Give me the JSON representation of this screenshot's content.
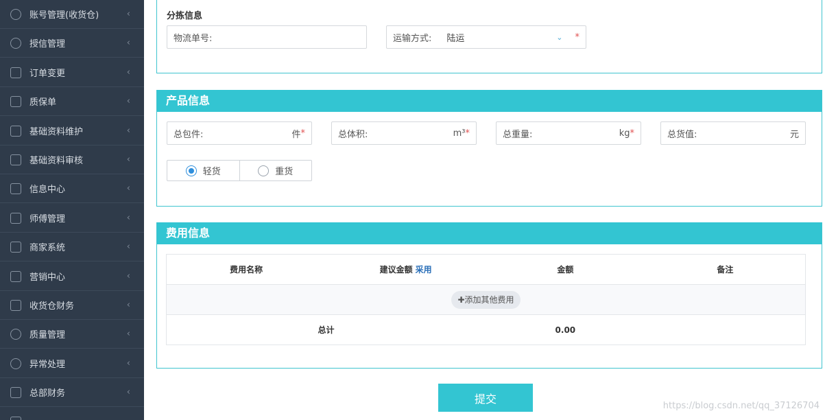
{
  "sidebar": {
    "items": [
      {
        "label": "账号管理(收货仓)",
        "icon": "gear-icon"
      },
      {
        "label": "授信管理",
        "icon": "user-icon"
      },
      {
        "label": "订单变更",
        "icon": "doc-icon"
      },
      {
        "label": "质保单",
        "icon": "doc-icon"
      },
      {
        "label": "基础资料维护",
        "icon": "grid-icon"
      },
      {
        "label": "基础资料审核",
        "icon": "grid-icon"
      },
      {
        "label": "信息中心",
        "icon": "grid-icon"
      },
      {
        "label": "师傅管理",
        "icon": "grid-icon"
      },
      {
        "label": "商家系统",
        "icon": "store-icon"
      },
      {
        "label": "营销中心",
        "icon": "edit-icon"
      },
      {
        "label": "收货仓财务",
        "icon": "wallet-icon"
      },
      {
        "label": "质量管理",
        "icon": "shield-icon"
      },
      {
        "label": "异常处理",
        "icon": "alert-icon"
      },
      {
        "label": "总部财务",
        "icon": "copy-icon"
      }
    ],
    "chevron": "‹"
  },
  "sorting": {
    "title": "分拣信息",
    "tracking_label": "物流单号:",
    "shipping_label": "运输方式:",
    "shipping_value": "陆运",
    "required_mark": "*"
  },
  "product": {
    "title": "产品信息",
    "packages_label": "总包件:",
    "packages_unit": "件",
    "volume_label": "总体积:",
    "volume_unit": "m³",
    "weight_label": "总重量:",
    "weight_unit": "kg",
    "value_label": "总货值:",
    "value_unit": "元",
    "cargo_options": [
      "轻货",
      "重货"
    ],
    "cargo_selected": "轻货"
  },
  "fees": {
    "title": "费用信息",
    "columns": [
      "费用名称",
      "建议金额",
      "金额",
      "备注"
    ],
    "adopt_label": "采用",
    "add_button": "添加其他费用",
    "total_label": "总计",
    "total_value": "0.00"
  },
  "submit_label": "提交",
  "watermark": "https://blog.csdn.net/qq_37126704",
  "colors": {
    "accent": "#33c5d2",
    "sidebar": "#2f3b4a",
    "required": "#e05050",
    "link": "#2a6fb8"
  }
}
